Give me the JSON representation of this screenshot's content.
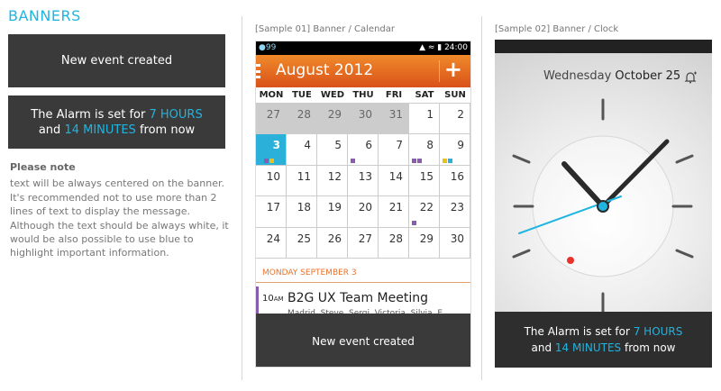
{
  "heading": "BANNERS",
  "banner_simple": {
    "text": "New event created"
  },
  "banner_alarm": {
    "prefix": "The Alarm is set for",
    "hours": "7 HOURS",
    "and": "and",
    "minutes": "14 MINUTES",
    "suffix": "from now"
  },
  "note": {
    "title": "Please note",
    "body": "text will be always centered on the banner. It's recommended not to use more than 2 lines of text to display the message. Although the text should be always white, it would be also possible to use blue to highlight important information."
  },
  "sample1": {
    "label": "[Sample 01] Banner / Calendar",
    "status": {
      "left": "99",
      "time": "24:00"
    },
    "month": "August 2012",
    "add_label": "+",
    "weekdays": [
      "MON",
      "TUE",
      "WED",
      "THU",
      "FRI",
      "SAT",
      "SUN"
    ],
    "weeks": [
      [
        "27",
        "28",
        "29",
        "30",
        "31",
        "1",
        "2"
      ],
      [
        "3",
        "4",
        "5",
        "6",
        "7",
        "8",
        "9"
      ],
      [
        "10",
        "11",
        "12",
        "13",
        "14",
        "15",
        "16"
      ],
      [
        "17",
        "18",
        "19",
        "20",
        "21",
        "22",
        "23"
      ],
      [
        "24",
        "25",
        "26",
        "27",
        "28",
        "29",
        "30"
      ]
    ],
    "selected_date": "MONDAY SEPTEMBER 3",
    "event": {
      "time": "10",
      "ampm": "AM",
      "title": "B2G UX Team Meeting",
      "people": "Madrid, Steve, Sergi, Victoria, Silvia, E"
    },
    "banner": "New event created"
  },
  "sample2": {
    "label": "[Sample 02] Banner / Clock",
    "weekday": "Wednesday",
    "date": "October 25",
    "banner": {
      "prefix": "The Alarm is set for",
      "hours": "7 HOURS",
      "and": "and",
      "minutes": "14 MINUTES",
      "suffix": "from now"
    }
  },
  "colors": {
    "accent": "#1fb5e0",
    "banner_bg": "#3a3a3a",
    "calendar_header": "#e06a22",
    "today": "#2bb1d9",
    "alarm_dot": "#e8322a"
  }
}
